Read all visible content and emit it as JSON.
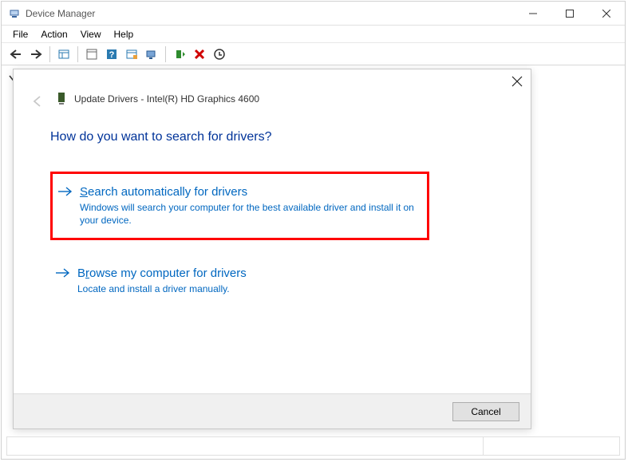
{
  "window": {
    "title": "Device Manager"
  },
  "menu": {
    "file": "File",
    "action": "Action",
    "view": "View",
    "help": "Help"
  },
  "toolbar_icons": {
    "back": "back-arrow-icon",
    "forward": "forward-arrow-icon",
    "properties": "properties-icon",
    "refresh": "refresh-icon",
    "help": "help-icon",
    "show_hidden": "show-hidden-icon",
    "scan": "scan-hardware-icon",
    "enable": "enable-device-icon",
    "disable": "disable-device-icon",
    "uninstall": "uninstall-icon"
  },
  "wizard": {
    "header": "Update Drivers - Intel(R) HD Graphics 4600",
    "question": "How do you want to search for drivers?",
    "option1": {
      "title_prefix": "S",
      "title_rest": "earch automatically for drivers",
      "desc": "Windows will search your computer for the best available driver and install it on your device."
    },
    "option2": {
      "title_prefix": "B",
      "title_mid": "r",
      "title_rest": "owse my computer for drivers",
      "desc": "Locate and install a driver manually."
    },
    "cancel": "Cancel"
  }
}
